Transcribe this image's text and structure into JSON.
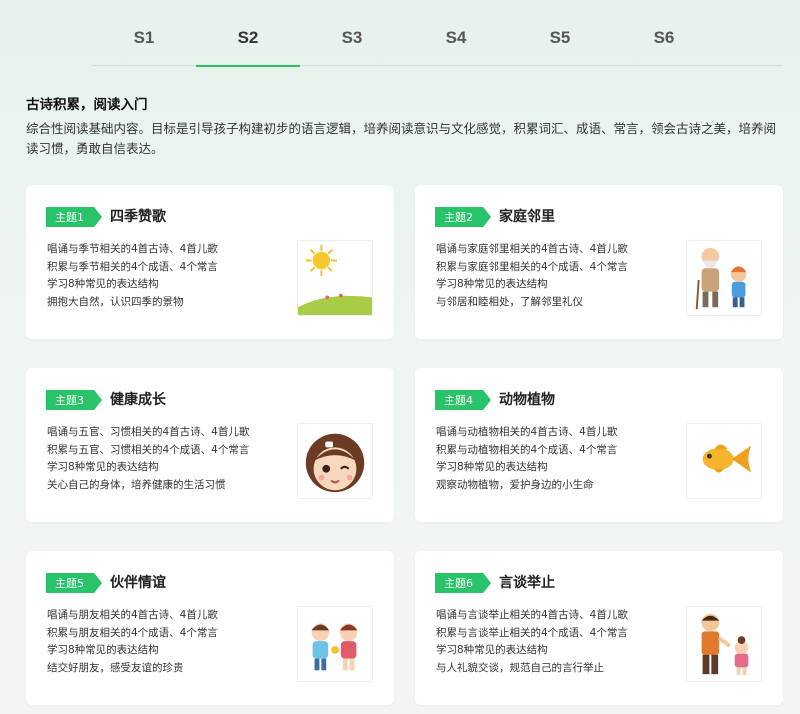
{
  "tabs": [
    {
      "label": "S1",
      "active": false
    },
    {
      "label": "S2",
      "active": true
    },
    {
      "label": "S3",
      "active": false
    },
    {
      "label": "S4",
      "active": false
    },
    {
      "label": "S5",
      "active": false
    },
    {
      "label": "S6",
      "active": false
    }
  ],
  "intro": {
    "title": "古诗积累，阅读入门",
    "description": "综合性阅读基础内容。目标是引导孩子构建初步的语言逻辑，培养阅读意识与文化感觉，积累词汇、成语、常言，领会古诗之美，培养阅读习惯，勇敢自信表达。"
  },
  "colors": {
    "accent": "#29c46a"
  },
  "themes": [
    {
      "tag": "主题1",
      "title": "四季赞歌",
      "icon": "sun-landscape-icon",
      "lines": [
        "唱诵与季节相关的4首古诗、4首儿歌",
        "积累与季节相关的4个成语、4个常言",
        "学习8种常见的表达结构",
        "拥抱大自然，认识四季的景物"
      ]
    },
    {
      "tag": "主题2",
      "title": "家庭邻里",
      "icon": "grandpa-and-child-icon",
      "lines": [
        "唱诵与家庭邻里相关的4首古诗、4首儿歌",
        "积累与家庭邻里相关的4个成语、4个常言",
        "学习8种常见的表达结构",
        "与邻居和睦相处，了解邻里礼仪"
      ]
    },
    {
      "tag": "主题3",
      "title": "健康成长",
      "icon": "girl-face-icon",
      "lines": [
        "唱诵与五官、习惯相关的4首古诗、4首儿歌",
        "积累与五官、习惯相关的4个成语、4个常言",
        "学习8种常见的表达结构",
        "关心自己的身体，培养健康的生活习惯"
      ]
    },
    {
      "tag": "主题4",
      "title": "动物植物",
      "icon": "goldfish-icon",
      "lines": [
        "唱诵与动植物相关的4首古诗、4首儿歌",
        "积累与动植物相关的4个成语、4个常言",
        "学习8种常见的表达结构",
        "观察动物植物，爱护身边的小生命"
      ]
    },
    {
      "tag": "主题5",
      "title": "伙伴情谊",
      "icon": "two-friends-icon",
      "lines": [
        "唱诵与朋友相关的4首古诗、4首儿歌",
        "积累与朋友相关的4个成语、4个常言",
        "学习8种常见的表达结构",
        "结交好朋友，感受友谊的珍贵"
      ]
    },
    {
      "tag": "主题6",
      "title": "言谈举止",
      "icon": "polite-greeting-icon",
      "lines": [
        "唱诵与言谈举止相关的4首古诗、4首儿歌",
        "积累与言谈举止相关的4个成语、4个常言",
        "学习8种常见的表达结构",
        "与人礼貌交谈，规范自己的言行举止"
      ]
    }
  ]
}
